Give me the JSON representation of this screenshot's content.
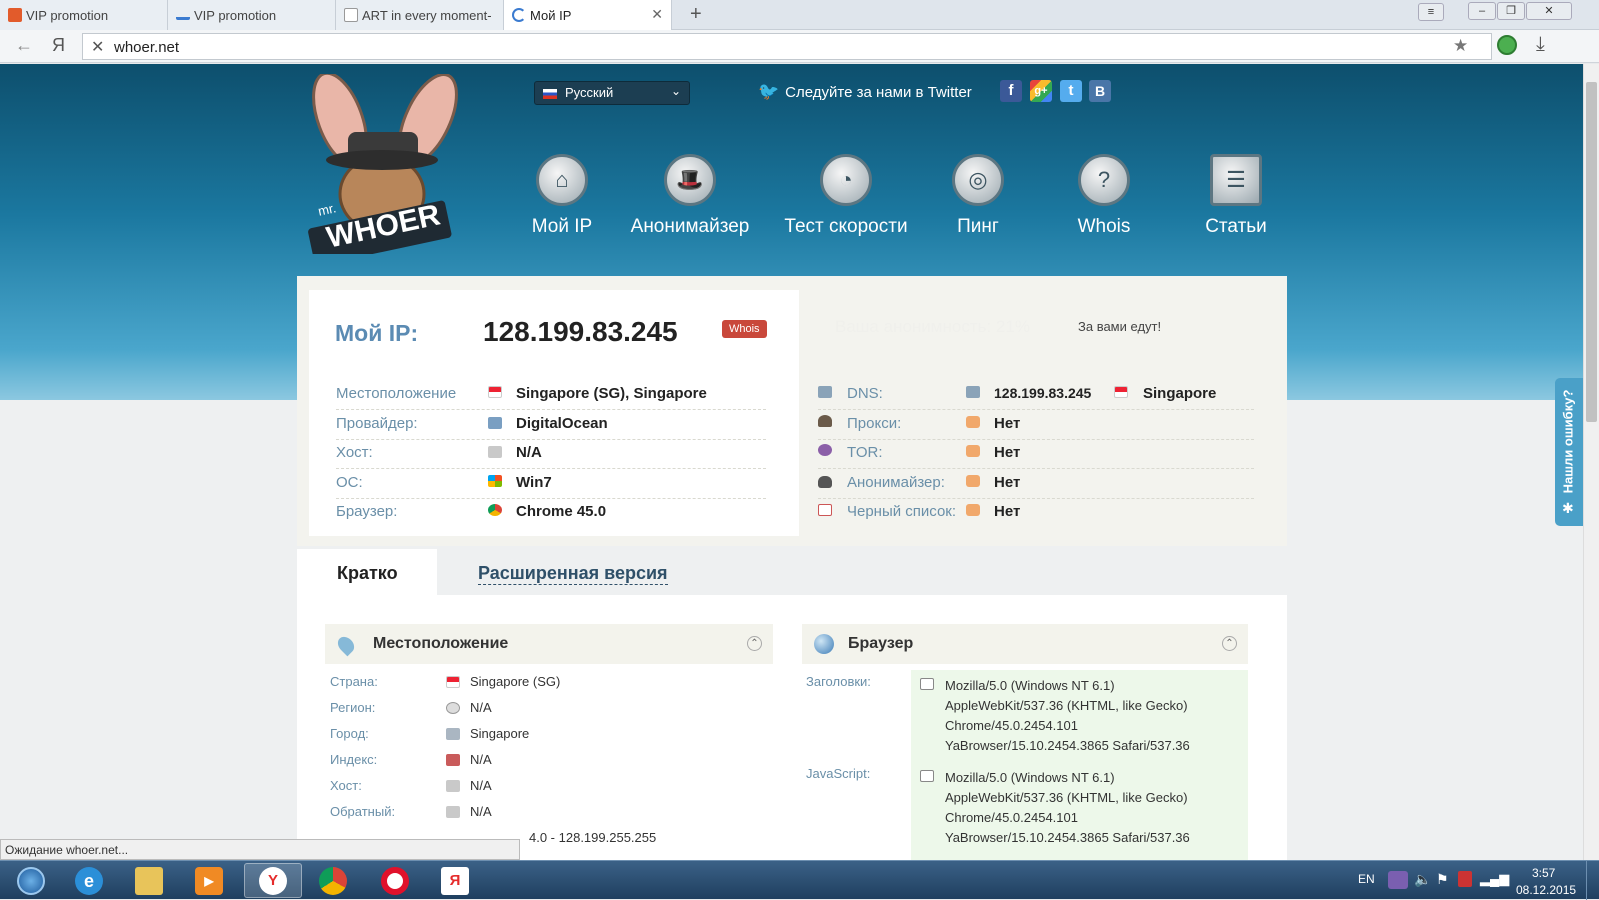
{
  "browser": {
    "tabs": [
      {
        "label": "VIP promotion",
        "active": false
      },
      {
        "label": "VIP promotion",
        "active": false
      },
      {
        "label": "ART in every moment-",
        "active": false
      },
      {
        "label": "Мой IP",
        "active": true
      }
    ],
    "url": "whoer.net",
    "status": "Ожидание whoer.net...",
    "yandex_letter": "Я"
  },
  "header": {
    "logo_small": "mr.",
    "logo_text": "WHOER",
    "language": "Русский",
    "twitter": "Следуйте за нами в Twitter",
    "social": [
      "f",
      "g+",
      "t",
      "B"
    ],
    "nav": [
      {
        "label": "Мой IP",
        "icon": "home-icon"
      },
      {
        "label": "Анонимайзер",
        "icon": "spy-hat-icon"
      },
      {
        "label": "Тест скорости",
        "icon": "speedometer-icon"
      },
      {
        "label": "Пинг",
        "icon": "ping-icon"
      },
      {
        "label": "Whois",
        "icon": "question-icon"
      },
      {
        "label": "Статьи",
        "icon": "notepad-icon"
      }
    ]
  },
  "ip": {
    "label": "Мой IP:",
    "value": "128.199.83.245",
    "whois_badge": "Whois",
    "anonymity": "Ваша анонимность: 21%",
    "watched": "За вами едут!"
  },
  "left_info": [
    {
      "label": "Местоположение",
      "value": "Singapore (SG), Singapore"
    },
    {
      "label": "Провайдер:",
      "value": "DigitalOcean"
    },
    {
      "label": "Хост:",
      "value": "N/A"
    },
    {
      "label": "ОС:",
      "value": "Win7"
    },
    {
      "label": "Браузер:",
      "value": "Chrome 45.0"
    }
  ],
  "right_info": [
    {
      "label": "DNS:",
      "value": "128.199.83.245",
      "extra": "Singapore"
    },
    {
      "label": "Прокси:",
      "value": "Нет"
    },
    {
      "label": "TOR:",
      "value": "Нет"
    },
    {
      "label": "Анонимайзер:",
      "value": "Нет"
    },
    {
      "label": "Черный список:",
      "value": "Нет"
    }
  ],
  "tabs2": {
    "brief": "Кратко",
    "extended": "Расширенная версия"
  },
  "location": {
    "title": "Местоположение",
    "rows": [
      {
        "label": "Страна:",
        "value": "Singapore (SG)"
      },
      {
        "label": "Регион:",
        "value": "N/A"
      },
      {
        "label": "Город:",
        "value": "Singapore"
      },
      {
        "label": "Индекс:",
        "value": "N/A"
      },
      {
        "label": "Хост:",
        "value": "N/A"
      },
      {
        "label": "Обратный:",
        "value": "N/A"
      }
    ],
    "range_tail": "4.0 - 128.199.255.255"
  },
  "browser_panel": {
    "title": "Браузер",
    "headers_label": "Заголовки:",
    "headers_lines": [
      "Mozilla/5.0 (Windows NT 6.1)",
      "AppleWebKit/537.36 (KHTML, like Gecko)",
      "Chrome/45.0.2454.101",
      "YaBrowser/15.10.2454.3865 Safari/537.36"
    ],
    "js_label": "JavaScript:",
    "js_lines": [
      "Mozilla/5.0 (Windows NT 6.1)",
      "AppleWebKit/537.36 (KHTML, like Gecko)",
      "Chrome/45.0.2454.101",
      "YaBrowser/15.10.2454.3865 Safari/537.36"
    ]
  },
  "feedback_tab": "Нашли ошибку?",
  "taskbar": {
    "lang": "EN",
    "time": "3:57",
    "date": "08.12.2015",
    "yandex_letter": "Я"
  }
}
